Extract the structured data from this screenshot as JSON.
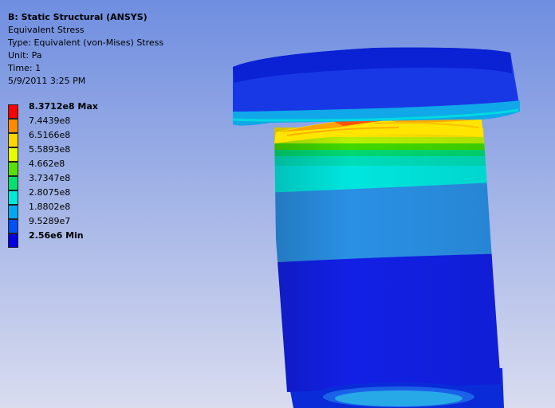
{
  "header": {
    "title": "B: Static Structural (ANSYS)",
    "result_type": "Equivalent Stress",
    "type_line": "Type: Equivalent (von-Mises) Stress",
    "unit_line": "Unit: Pa",
    "time_line": "Time: 1",
    "date_line": "5/9/2011 3:25 PM"
  },
  "legend": {
    "items": [
      {
        "label": "8.3712e8 Max",
        "color": "#ff0000"
      },
      {
        "label": "7.4439e8",
        "color": "#ff8c00"
      },
      {
        "label": "6.5166e8",
        "color": "#ffd400"
      },
      {
        "label": "5.5893e8",
        "color": "#e8ff00"
      },
      {
        "label": "4.662e8",
        "color": "#58e000"
      },
      {
        "label": "3.7347e8",
        "color": "#00e070"
      },
      {
        "label": "2.8075e8",
        "color": "#00e8d8"
      },
      {
        "label": "1.8802e8",
        "color": "#00a8f0"
      },
      {
        "label": "9.5289e7",
        "color": "#0050f8"
      },
      {
        "label": "2.56e6 Min",
        "color": "#0000e0"
      }
    ]
  },
  "colors": {
    "background_top": "#6f8ee0",
    "background_bottom": "#d9dcef"
  }
}
